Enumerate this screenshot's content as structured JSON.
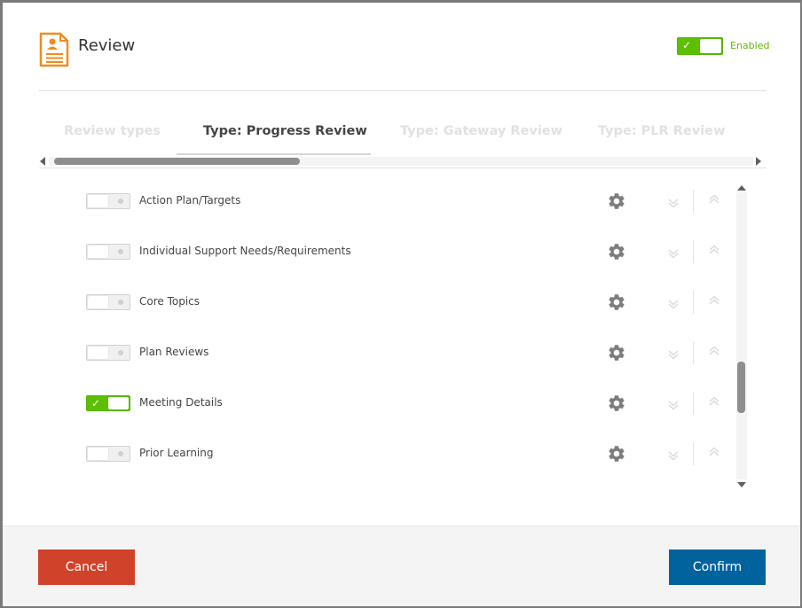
{
  "header": {
    "title": "Review",
    "enabled_label": "Enabled",
    "enabled": true
  },
  "tabs": [
    {
      "label": "Review types",
      "active": false
    },
    {
      "label": "Type: Progress Review",
      "active": true
    },
    {
      "label": "Type: Gateway Review",
      "active": false
    },
    {
      "label": "Type: PLR Review",
      "active": false
    }
  ],
  "sections": [
    {
      "label": "Action Plan/Targets",
      "enabled": false
    },
    {
      "label": "Individual Support Needs/Requirements",
      "enabled": false
    },
    {
      "label": "Core Topics",
      "enabled": false
    },
    {
      "label": "Plan Reviews",
      "enabled": false
    },
    {
      "label": "Meeting Details",
      "enabled": true
    },
    {
      "label": "Prior Learning",
      "enabled": false
    }
  ],
  "toggle_check": "✓",
  "footer": {
    "cancel_label": "Cancel",
    "confirm_label": "Confirm"
  },
  "colors": {
    "accent_orange": "#f08c1e",
    "toggle_on": "#5cc000",
    "cancel": "#d0432a",
    "confirm": "#00639e"
  },
  "icons": {
    "header": "review-document-icon",
    "settings": "gear-icon",
    "move_down": "arrow-down-icon",
    "move_up": "arrow-up-icon"
  }
}
